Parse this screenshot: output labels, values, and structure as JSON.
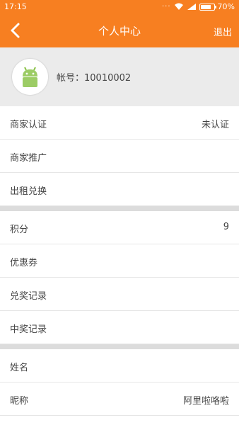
{
  "status": {
    "time": "17:15",
    "battery": "70%",
    "battery_level": 0.7
  },
  "header": {
    "title": "个人中心",
    "logout_label": "退出",
    "back_icon": "chevron-left-icon",
    "accent": "#f77f21"
  },
  "profile": {
    "account": "帐号：10010002",
    "avatar_icon": "android-icon"
  },
  "group1": [
    {
      "label": "商家认证",
      "value": "未认证"
    },
    {
      "label": "商家推广",
      "value": ""
    },
    {
      "label": "出租兑换",
      "value": ""
    }
  ],
  "group2": [
    {
      "label": "积分",
      "value": "9"
    },
    {
      "label": "优惠券",
      "value": ""
    },
    {
      "label": "兑奖记录",
      "value": ""
    },
    {
      "label": "中奖记录",
      "value": ""
    }
  ],
  "group3": [
    {
      "label": "姓名",
      "value": ""
    },
    {
      "label": "昵称",
      "value": "阿里啦咯啦"
    }
  ]
}
